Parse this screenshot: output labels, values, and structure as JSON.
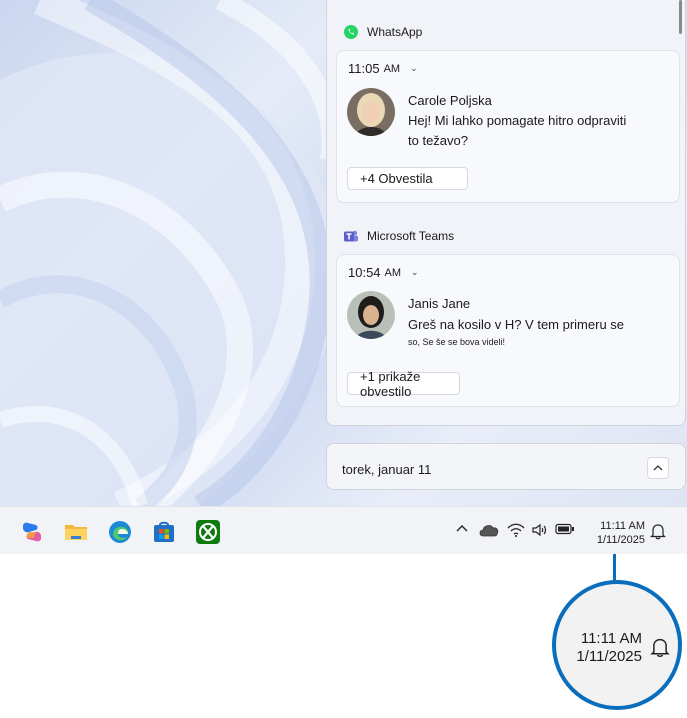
{
  "notifications": [
    {
      "app": "WhatsApp",
      "time": "11:05",
      "ampm": "AM",
      "sender": "Carole Poljska",
      "message": "Hej! Mi lahko pomagate hitro odpraviti to težavo?",
      "message_small": "",
      "more": "+4 Obvestila"
    },
    {
      "app": "Microsoft Teams",
      "time": "10:54",
      "ampm": "AM",
      "sender": "Janis Jane",
      "message": "Greš na kosilo v H? V tem primeru se",
      "message_small": "so, Se še se bova videli!",
      "more": "+1 prikaže obvestilo"
    }
  ],
  "date_bar": {
    "date": "torek, januar 11"
  },
  "taskbar": {
    "apps": [
      "copilot-icon",
      "file-explorer-icon",
      "edge-icon",
      "store-icon",
      "xbox-icon"
    ],
    "clock_time": "11:11 AM",
    "clock_date": "1/11/2025"
  },
  "zoom_callout": {
    "time": "11:11 AM",
    "date": "1/11/2025"
  },
  "colors": {
    "accent": "#0a6ebd",
    "whatsapp": "#25d366",
    "teams": "#5b5fc7"
  }
}
